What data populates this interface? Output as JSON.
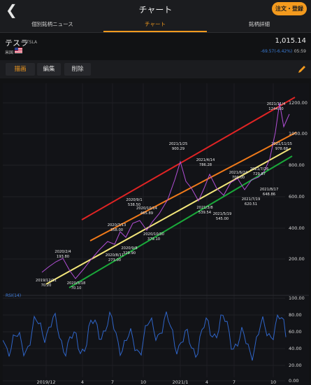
{
  "header": {
    "title": "チャート",
    "order_button": "注文・登録"
  },
  "tabs": [
    {
      "label": "個別銘柄ニュース",
      "active": false
    },
    {
      "label": "チャート",
      "active": true
    },
    {
      "label": "銘柄詳細",
      "active": false
    }
  ],
  "stock": {
    "name": "テスラ",
    "ticker": "TSLA",
    "price": "1,015.14",
    "market": "米国",
    "change": "-69.57(-6.42%)",
    "time": "05:59"
  },
  "toolbar": {
    "draw_label": "描画",
    "edit_label": "編集",
    "delete_label": "削除"
  },
  "colors": {
    "accent": "#f39a1e",
    "line_red": "#e02424",
    "line_orange": "#f07a1a",
    "line_yellow": "#f3e67a",
    "line_green": "#1aa83a",
    "price_line": "#b24fd6",
    "rsi": "#2f65c9"
  },
  "chart_data": {
    "type": "line",
    "price_y_ticks": [
      "1200.00",
      "1000.00",
      "800.00",
      "600.00",
      "400.00",
      "200.00"
    ],
    "rsi_label": "RSI(14)",
    "rsi_y_ticks": [
      "100.00",
      "80.00",
      "60.00",
      "40.00",
      "20.00",
      "0.00"
    ],
    "x_labels": [
      "2019/12",
      "4",
      "7",
      "10",
      "2021/1",
      "4",
      "7",
      "10"
    ],
    "annotations": [
      {
        "date": "2019/12/11",
        "value": "70.20"
      },
      {
        "date": "2020/2/4",
        "value": "193.80"
      },
      {
        "date": "2020/3/18",
        "value": "70.10"
      },
      {
        "date": "2020/7/13",
        "value": "358.00"
      },
      {
        "date": "2020/8/11",
        "value": "273.00"
      },
      {
        "date": "2020/9/1",
        "value": "538.50"
      },
      {
        "date": "2020/9/8",
        "value": "329.90"
      },
      {
        "date": "2020/10/14",
        "value": "465.89"
      },
      {
        "date": "2020/10/30",
        "value": "379.10"
      },
      {
        "date": "2021/1/25",
        "value": "900.29"
      },
      {
        "date": "2021/3/8",
        "value": "539.54"
      },
      {
        "date": "2021/4/14",
        "value": "786.28"
      },
      {
        "date": "2021/5/19",
        "value": "545.00"
      },
      {
        "date": "2021/6/24",
        "value": "700.00"
      },
      {
        "date": "2021/7/19",
        "value": "620.51"
      },
      {
        "date": "2021/7/26",
        "value": "729.87"
      },
      {
        "date": "2021/8/17",
        "value": "648.86"
      },
      {
        "date": "2021/11/4",
        "value": "1244.00"
      },
      {
        "date": "2021/11/15",
        "value": "978.68"
      }
    ]
  }
}
